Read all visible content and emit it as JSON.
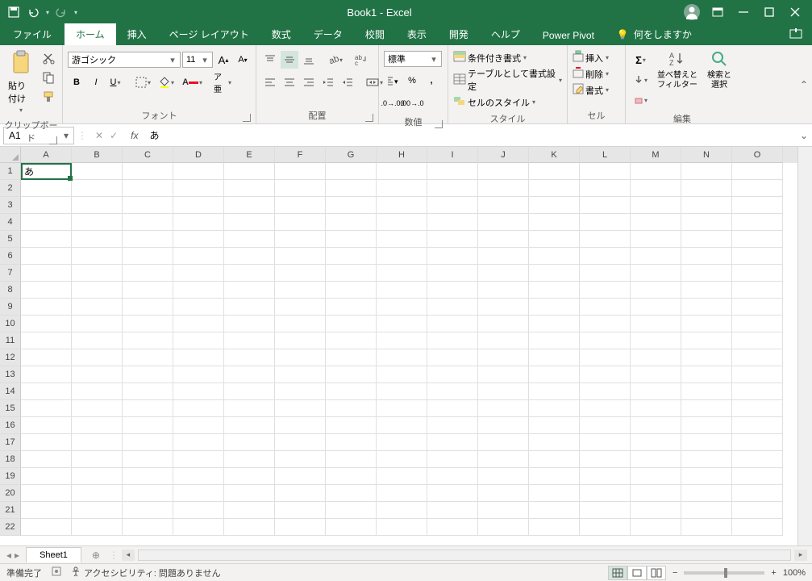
{
  "title": "Book1 - Excel",
  "tabs": {
    "file": "ファイル",
    "home": "ホーム",
    "insert": "挿入",
    "pageLayout": "ページ レイアウト",
    "formulas": "数式",
    "data": "データ",
    "review": "校閲",
    "view": "表示",
    "developer": "開発",
    "help": "ヘルプ",
    "powerPivot": "Power Pivot",
    "tellMe": "何をしますか"
  },
  "ribbon": {
    "clipboard": {
      "paste": "貼り付け",
      "label": "クリップボード"
    },
    "font": {
      "name": "游ゴシック",
      "size": "11",
      "label": "フォント"
    },
    "align": {
      "label": "配置"
    },
    "number": {
      "format": "標準",
      "label": "数値"
    },
    "styles": {
      "cond": "条件付き書式",
      "table": "テーブルとして書式設定",
      "cell": "セルのスタイル",
      "label": "スタイル"
    },
    "cells": {
      "insert": "挿入",
      "delete": "削除",
      "format": "書式",
      "label": "セル"
    },
    "editing": {
      "sort": "並べ替えと\nフィルター",
      "find": "検索と\n選択",
      "label": "編集"
    }
  },
  "namebox": "A1",
  "formula": "あ",
  "cellA1": "あ",
  "cols": [
    "A",
    "B",
    "C",
    "D",
    "E",
    "F",
    "G",
    "H",
    "I",
    "J",
    "K",
    "L",
    "M",
    "N",
    "O"
  ],
  "rows": [
    "1",
    "2",
    "3",
    "4",
    "5",
    "6",
    "7",
    "8",
    "9",
    "10",
    "11",
    "12",
    "13",
    "14",
    "15",
    "16",
    "17",
    "18",
    "19",
    "20",
    "21",
    "22"
  ],
  "sheetTab": "Sheet1",
  "status": {
    "ready": "準備完了",
    "access": "アクセシビリティ: 問題ありません",
    "zoom": "100%"
  }
}
